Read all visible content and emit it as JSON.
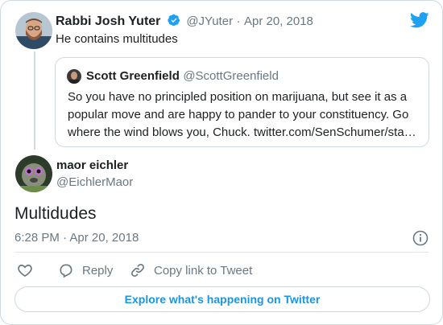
{
  "parent": {
    "name": "Rabbi Josh Yuter",
    "handle": "@JYuter",
    "separator": "·",
    "date": "Apr 20, 2018",
    "text": "He contains multitudes"
  },
  "quote": {
    "name": "Scott Greenfield",
    "handle": "@ScottGreenfield",
    "text": "So you have no principled position on marijuana, but see it as a popular move and are happy to pander to your constituency. Go where the wind blows you, Chuck. twitter.com/SenSchumer/sta…"
  },
  "reply": {
    "name": "maor eichler",
    "handle": "@EichlerMaor",
    "text": "Multidudes",
    "time": "6:28 PM",
    "separator": "·",
    "date": "Apr 20, 2018"
  },
  "actions": {
    "reply_label": "Reply",
    "copy_label": "Copy link to Tweet"
  },
  "footer": {
    "explore_label": "Explore what's happening on Twitter"
  },
  "colors": {
    "twitter_blue": "#1b95e0",
    "verified_blue": "#1da1f2",
    "meta_gray": "#697882",
    "border": "#cfd9de"
  },
  "icons": [
    "twitter-bird-icon",
    "verified-icon",
    "info-icon",
    "heart-icon",
    "reply-icon",
    "link-icon"
  ]
}
